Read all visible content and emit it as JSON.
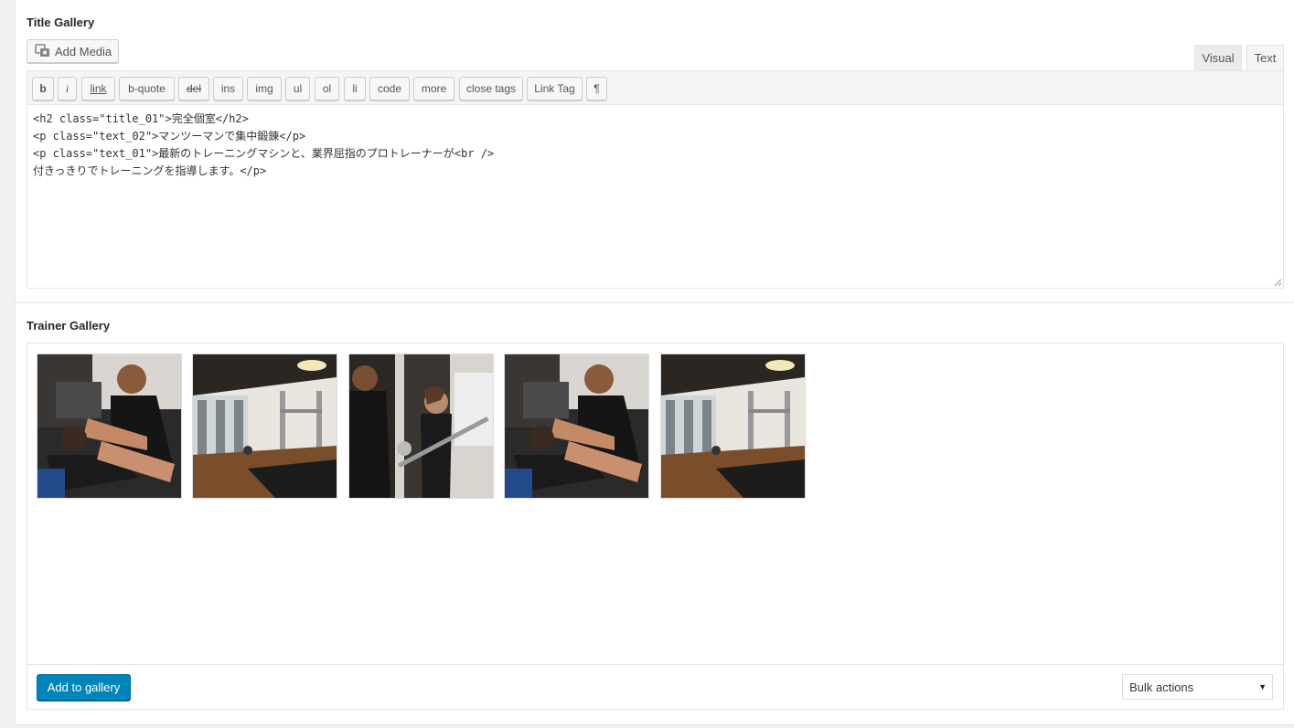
{
  "title_gallery": {
    "heading": "Title Gallery",
    "add_media_label": "Add Media",
    "tabs": [
      {
        "label": "Visual"
      },
      {
        "label": "Text"
      }
    ],
    "quicktags": [
      {
        "label": "b"
      },
      {
        "label": "i"
      },
      {
        "label": "link"
      },
      {
        "label": "b-quote"
      },
      {
        "label": "del"
      },
      {
        "label": "ins"
      },
      {
        "label": "img"
      },
      {
        "label": "ul"
      },
      {
        "label": "ol"
      },
      {
        "label": "li"
      },
      {
        "label": "code"
      },
      {
        "label": "more"
      },
      {
        "label": "close tags"
      },
      {
        "label": "Link Tag"
      },
      {
        "label": "¶"
      }
    ],
    "content_lines": [
      "<h2 class=\"title_01\">完全個室</h2>",
      "<p class=\"text_02\">マンツーマンで集中鍛錬</p>",
      "<p class=\"text_01\">最新のトレーニングマシンと、業界屈指のプロトレーナーが<br />",
      "付きっきりでトレーニングを指導します。</p>"
    ]
  },
  "trainer_gallery": {
    "heading": "Trainer Gallery",
    "images": [
      {
        "alt": "trainer-assisting-situp"
      },
      {
        "alt": "gym-room-interior"
      },
      {
        "alt": "trainer-barbell-squat"
      },
      {
        "alt": "trainer-assisting-situp"
      },
      {
        "alt": "gym-room-interior"
      }
    ],
    "add_button_label": "Add to gallery",
    "bulk_actions": {
      "selected": "Bulk actions"
    }
  },
  "colors": {
    "primary": "#0085ba",
    "background": "#f1f1f1",
    "panel": "#ffffff"
  }
}
